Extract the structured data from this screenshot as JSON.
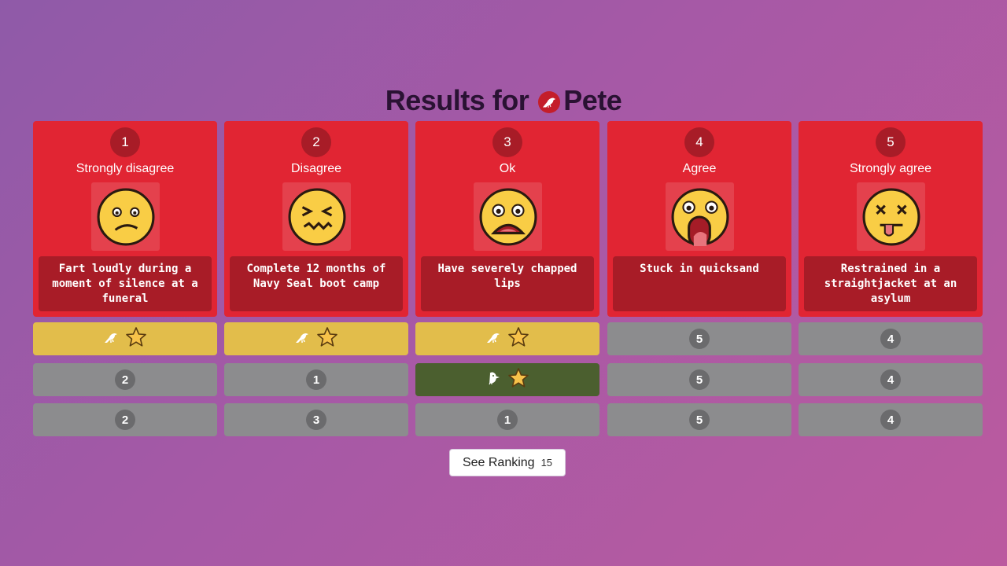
{
  "title": {
    "prefix": "Results for",
    "player": "Pete",
    "player_icon": "bird-icon"
  },
  "columns": [
    {
      "number": "1",
      "label": "Strongly disagree",
      "face": "confused-face",
      "scenario": "Fart loudly during a moment of silence at a funeral"
    },
    {
      "number": "2",
      "label": "Disagree",
      "face": "grimace-face",
      "scenario": "Complete 12 months of Navy Seal boot camp"
    },
    {
      "number": "3",
      "label": "Ok",
      "face": "shocked-face",
      "scenario": "Have severely chapped lips"
    },
    {
      "number": "4",
      "label": "Agree",
      "face": "screaming-face",
      "scenario": "Stuck in quicksand"
    },
    {
      "number": "5",
      "label": "Strongly agree",
      "face": "dizzy-face",
      "scenario": "Restrained in a straightjacket at an asylum"
    }
  ],
  "rows": [
    [
      {
        "type": "player",
        "icon": "bird-icon",
        "star": true,
        "color": "#e2bd4b"
      },
      {
        "type": "player",
        "icon": "bird-icon",
        "star": true,
        "color": "#e2bd4b"
      },
      {
        "type": "player",
        "icon": "bird-icon",
        "star": true,
        "color": "#e2bd4b"
      },
      {
        "type": "number",
        "value": "5"
      },
      {
        "type": "number",
        "value": "4"
      }
    ],
    [
      {
        "type": "number",
        "value": "2"
      },
      {
        "type": "number",
        "value": "1"
      },
      {
        "type": "player",
        "icon": "chick-icon",
        "star": true,
        "color": "#4b5f2f"
      },
      {
        "type": "number",
        "value": "5"
      },
      {
        "type": "number",
        "value": "4"
      }
    ],
    [
      {
        "type": "number",
        "value": "2"
      },
      {
        "type": "number",
        "value": "3"
      },
      {
        "type": "number",
        "value": "1"
      },
      {
        "type": "number",
        "value": "5"
      },
      {
        "type": "number",
        "value": "4"
      }
    ]
  ],
  "ranking_button": {
    "label": "See Ranking",
    "count": "15"
  },
  "colors": {
    "card": "#e12533",
    "card_dark": "#a81c27",
    "gold": "#e2bd4b",
    "green": "#4b5f2f",
    "gray": "#8c8c8e"
  }
}
